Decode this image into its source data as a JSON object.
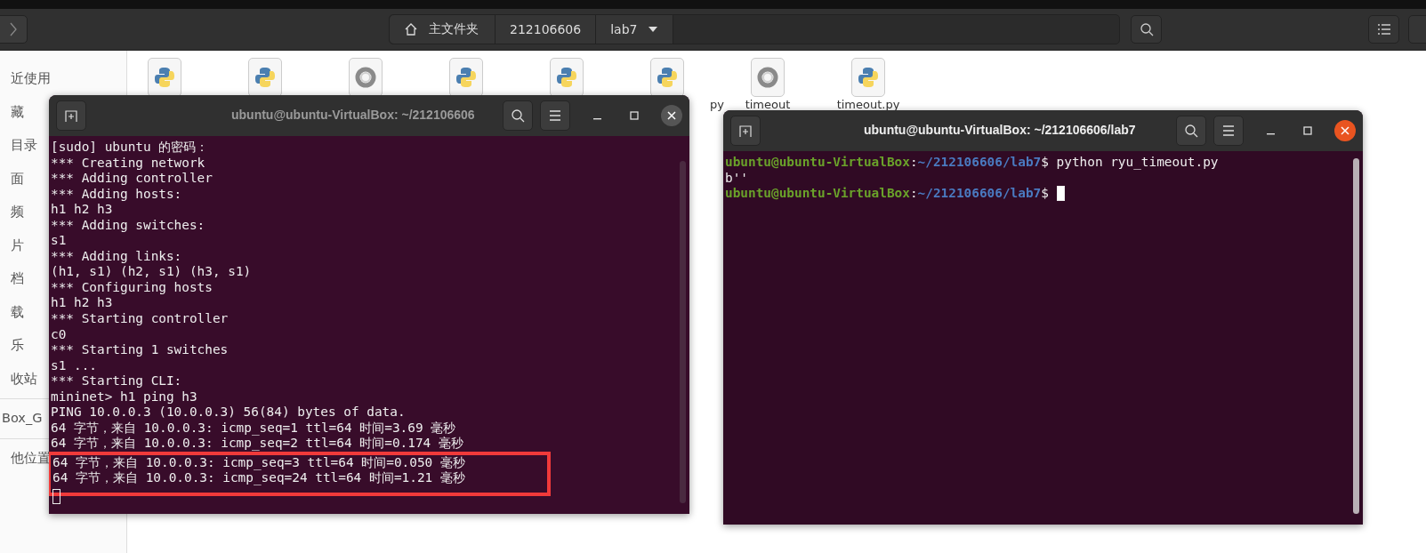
{
  "file_manager": {
    "path": [
      {
        "label": "主文件夹",
        "kind": "home"
      },
      {
        "label": "212106606",
        "kind": "plain"
      },
      {
        "label": "lab7",
        "kind": "dropdown"
      }
    ],
    "sidebar": [
      [
        {
          "label": "近使用"
        },
        {
          "label": "藏"
        },
        {
          "label": "目录"
        },
        {
          "label": "面"
        },
        {
          "label": "频"
        },
        {
          "label": "片"
        },
        {
          "label": "档"
        },
        {
          "label": "载"
        },
        {
          "label": "乐"
        },
        {
          "label": "收站"
        }
      ],
      [
        {
          "label": "Box_G"
        }
      ],
      [
        {
          "label": "他位置"
        }
      ]
    ],
    "files": [
      {
        "kind": "python"
      },
      {
        "kind": "python"
      },
      {
        "kind": "json"
      },
      {
        "kind": "python"
      },
      {
        "kind": "python"
      },
      {
        "kind": "python",
        "name": "py",
        "cut": true
      },
      {
        "kind": "json",
        "name": "timeout",
        "cut": false
      },
      {
        "kind": "python",
        "name": "timeout.py",
        "cut": false
      }
    ]
  },
  "terminals": [
    {
      "title": "ubuntu@ubuntu-VirtualBox: ~/212106606",
      "focused": false,
      "lines": [
        {
          "highlighted": false,
          "parts": [
            {
              "kind": "text",
              "text": "[sudo] ubuntu 的密码："
            }
          ]
        },
        {
          "highlighted": false,
          "parts": [
            {
              "kind": "text",
              "text": "*** Creating network"
            }
          ]
        },
        {
          "highlighted": false,
          "parts": [
            {
              "kind": "text",
              "text": "*** Adding controller"
            }
          ]
        },
        {
          "highlighted": false,
          "parts": [
            {
              "kind": "text",
              "text": "*** Adding hosts:"
            }
          ]
        },
        {
          "highlighted": false,
          "parts": [
            {
              "kind": "text",
              "text": "h1 h2 h3"
            }
          ]
        },
        {
          "highlighted": false,
          "parts": [
            {
              "kind": "text",
              "text": "*** Adding switches:"
            }
          ]
        },
        {
          "highlighted": false,
          "parts": [
            {
              "kind": "text",
              "text": "s1"
            }
          ]
        },
        {
          "highlighted": false,
          "parts": [
            {
              "kind": "text",
              "text": "*** Adding links:"
            }
          ]
        },
        {
          "highlighted": false,
          "parts": [
            {
              "kind": "text",
              "text": "(h1, s1) (h2, s1) (h3, s1)"
            }
          ]
        },
        {
          "highlighted": false,
          "parts": [
            {
              "kind": "text",
              "text": "*** Configuring hosts"
            }
          ]
        },
        {
          "highlighted": false,
          "parts": [
            {
              "kind": "text",
              "text": "h1 h2 h3"
            }
          ]
        },
        {
          "highlighted": false,
          "parts": [
            {
              "kind": "text",
              "text": "*** Starting controller"
            }
          ]
        },
        {
          "highlighted": false,
          "parts": [
            {
              "kind": "text",
              "text": "c0"
            }
          ]
        },
        {
          "highlighted": false,
          "parts": [
            {
              "kind": "text",
              "text": "*** Starting 1 switches"
            }
          ]
        },
        {
          "highlighted": false,
          "parts": [
            {
              "kind": "text",
              "text": "s1 ..."
            }
          ]
        },
        {
          "highlighted": false,
          "parts": [
            {
              "kind": "text",
              "text": "*** Starting CLI:"
            }
          ]
        },
        {
          "highlighted": false,
          "parts": [
            {
              "kind": "text",
              "text": "mininet> h1 ping h3"
            }
          ]
        },
        {
          "highlighted": false,
          "parts": [
            {
              "kind": "text",
              "text": "PING 10.0.0.3 (10.0.0.3) 56(84) bytes of data."
            }
          ]
        },
        {
          "highlighted": false,
          "parts": [
            {
              "kind": "text",
              "text": "64 字节，来自 10.0.0.3: icmp_seq=1 ttl=64 时间=3.69 毫秒"
            }
          ]
        },
        {
          "highlighted": false,
          "parts": [
            {
              "kind": "text",
              "text": "64 字节，来自 10.0.0.3: icmp_seq=2 ttl=64 时间=0.174 毫秒"
            }
          ]
        },
        {
          "highlighted": true,
          "parts": [
            {
              "kind": "text",
              "text": "64 字节，来自 10.0.0.3: icmp_seq=3 ttl=64 时间=0.050 毫秒"
            }
          ]
        },
        {
          "highlighted": true,
          "parts": [
            {
              "kind": "text",
              "text": "64 字节，来自 10.0.0.3: icmp_seq=24 ttl=64 时间=1.21 毫秒"
            }
          ]
        },
        {
          "highlighted": true,
          "parts": [
            {
              "kind": "cursor"
            }
          ]
        }
      ]
    },
    {
      "title": "ubuntu@ubuntu-VirtualBox: ~/212106606/lab7",
      "focused": true,
      "lines": [
        {
          "highlighted": false,
          "parts": [
            {
              "kind": "user",
              "text": "ubuntu@ubuntu-VirtualBox"
            },
            {
              "kind": "text",
              "text": ":"
            },
            {
              "kind": "path",
              "text": "~/212106606/lab7"
            },
            {
              "kind": "text",
              "text": "$ python ryu_timeout.py"
            }
          ]
        },
        {
          "highlighted": false,
          "parts": [
            {
              "kind": "text",
              "text": "b''"
            }
          ]
        },
        {
          "highlighted": false,
          "parts": [
            {
              "kind": "user",
              "text": "ubuntu@ubuntu-VirtualBox"
            },
            {
              "kind": "text",
              "text": ":"
            },
            {
              "kind": "path",
              "text": "~/212106606/lab7"
            },
            {
              "kind": "text",
              "text": "$ "
            },
            {
              "kind": "cursor"
            }
          ]
        }
      ]
    }
  ]
}
